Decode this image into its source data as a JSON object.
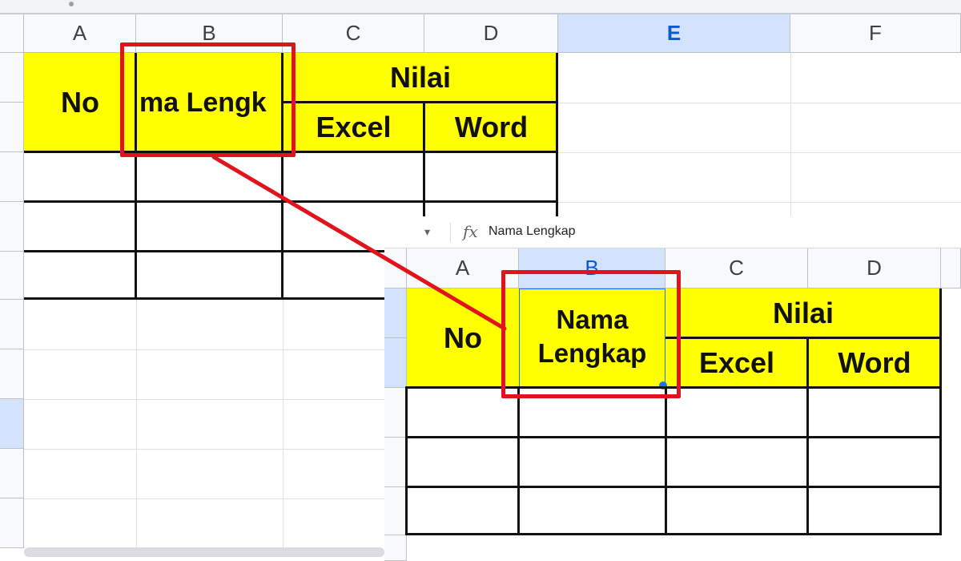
{
  "background_sheet": {
    "columns": [
      "A",
      "B",
      "C",
      "D",
      "E",
      "F"
    ],
    "selected_column": "E",
    "header_cells": {
      "no": "No",
      "nama_truncated": "ma Lengk",
      "nilai": "Nilai",
      "excel": "Excel",
      "word": "Word"
    }
  },
  "inset_sheet": {
    "formula_bar": {
      "fx_label": "fx",
      "value": "Nama Lengkap"
    },
    "columns": [
      "A",
      "B",
      "C",
      "D"
    ],
    "selected_column": "B",
    "header_cells": {
      "no": "No",
      "nama_line1": "Nama",
      "nama_line2": "Lengkap",
      "nilai": "Nilai",
      "excel": "Excel",
      "word": "Word"
    }
  },
  "colors": {
    "highlight_fill": "#ffff00",
    "annotation_red": "#e1141e",
    "selected_header": "#d3e3fd"
  }
}
